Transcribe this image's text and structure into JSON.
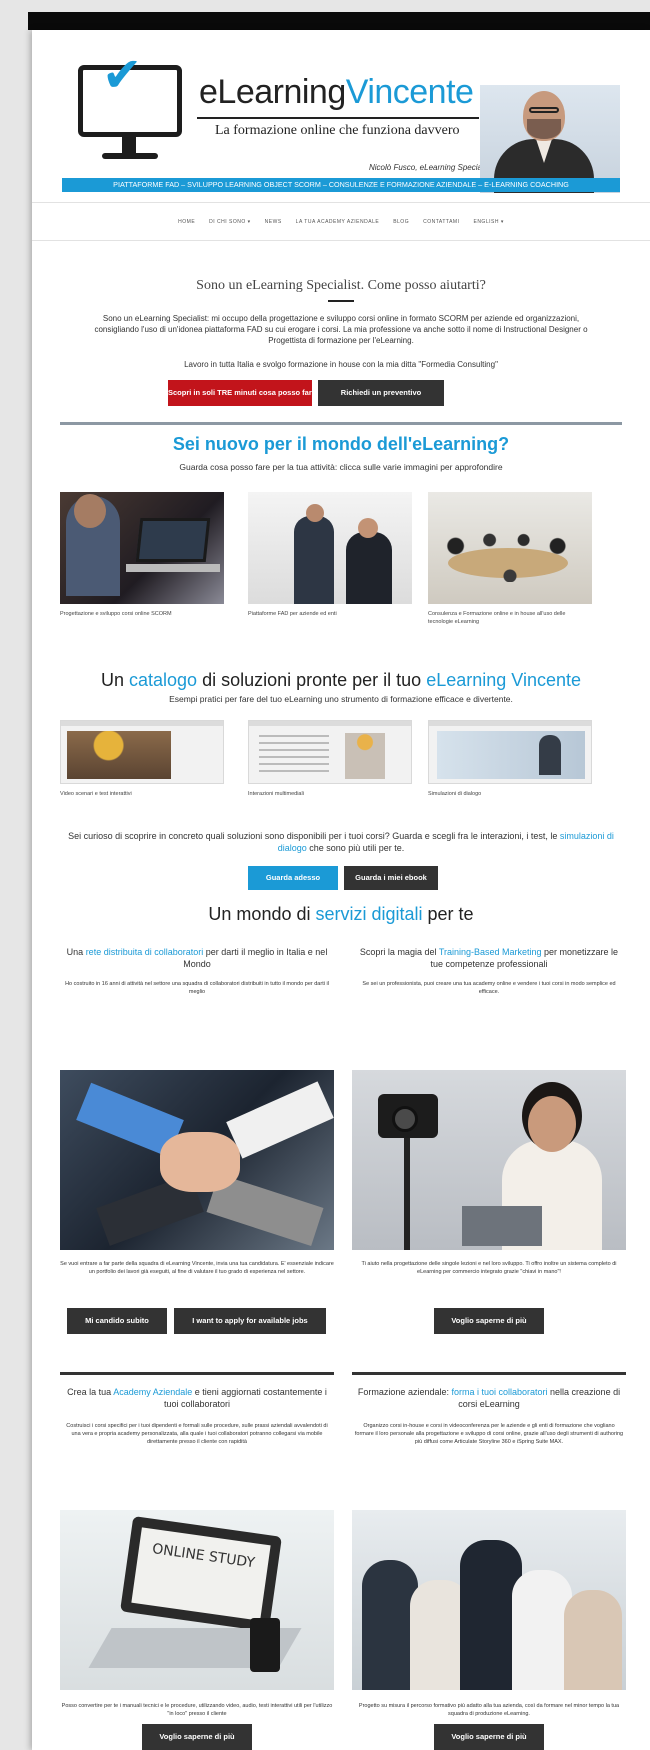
{
  "header": {
    "brand_part1": "eLearning",
    "brand_part2": "Vincente",
    "tagline": "La formazione online che funziona davvero",
    "author": "Nicolò Fusco, eLearning Specialist",
    "services_strip": "PIATTAFORME FAD – SVILUPPO LEARNING OBJECT SCORM – CONSULENZE E FORMAZIONE AZIENDALE – E-LEARNING COACHING",
    "colors": {
      "accent": "#1b9ad6",
      "dark": "#1d1d1d"
    }
  },
  "nav": {
    "items": [
      "HOME",
      "DI CHI SONO ▾",
      "NEWS",
      "LA TUA ACADEMY AZIENDALE",
      "BLOG",
      "CONTATTAMI",
      "ENGLISH ▾"
    ]
  },
  "intro": {
    "title": "Sono un eLearning Specialist. Come posso aiutarti?",
    "paragraph": "Sono un eLearning Specialist: mi occupo della progettazione e sviluppo corsi online in formato SCORM per aziende ed organizzazioni, consigliando l'uso di un'idonea piattaforma FAD su cui erogare i corsi. La mia professione va anche sotto il nome di Instructional Designer o Progettista di formazione per l'eLearning.",
    "paragraph2": "Lavoro in tutta Italia e svolgo formazione in house con la mia ditta \"Formedia Consulting\"",
    "btn_red": "Scopri in soli TRE minuti cosa posso fare per te",
    "btn_dark": "Richiedi un preventivo",
    "colors": {
      "red": "#c2141b",
      "dark": "#333333"
    }
  },
  "new_section": {
    "title": "Sei nuovo per il mondo dell'eLearning?",
    "subtitle": "Guarda cosa posso fare per la tua attività: clicca sulle varie immagini per approfondire",
    "cards": [
      {
        "caption": "Progettazione e sviluppo corsi online SCORM"
      },
      {
        "caption": "Piattaforme FAD per aziende ed enti"
      },
      {
        "caption": "Consulenza e Formazione online e in house all'uso delle tecnologie eLearning"
      }
    ]
  },
  "catalog": {
    "title_a": "Un ",
    "title_hl1": "catalogo",
    "title_b": " di soluzioni pronte per il tuo ",
    "title_hl2": "eLearning Vincente",
    "subtitle": "Esempi pratici per fare del tuo eLearning uno strumento di formazione efficace e divertente.",
    "items": [
      {
        "caption": "Video scenari e test interattivi"
      },
      {
        "caption": "Interazioni multimediali"
      },
      {
        "caption": "Simulazioni di dialogo"
      }
    ],
    "curious_a": "Sei curioso di scoprire in concreto quali soluzioni sono disponibili per i tuoi corsi? Guarda e scegli fra le interazioni, i test, le ",
    "curious_hl": "simulazioni di dialogo",
    "curious_b": " che sono più utili per te.",
    "btn_blue": "Guarda adesso",
    "btn_dark": "Guarda i miei ebook"
  },
  "services": {
    "title_a": "Un mondo di ",
    "title_hl": "servizi digitali",
    "title_b": " per te",
    "col1": {
      "head_a": "Una ",
      "head_hl": "rete distribuita di collaboratori",
      "head_b": " per darti il meglio in Italia e nel Mondo",
      "text": "Ho costruito in 16 anni di attività nel settore una squadra di collaboratori distribuiti in tutto il mondo per darti il meglio",
      "caption": "Se vuoi entrare a far parte della squadra di eLearning Vincente, invia una tua candidatura. E' essenziale indicare un portfolio dei lavori già eseguiti, al fine di valutare il tuo grado di esperienza nel settore.",
      "btn1": "Mi candido subito",
      "btn2": "I want to apply for available jobs"
    },
    "col2": {
      "head_a": "Scopri la magia del ",
      "head_hl": "Training-Based Marketing",
      "head_b": " per monetizzare le tue competenze professionali",
      "text": "Se sei un professionista, puoi creare una tua academy online e vendere i tuoi corsi in modo semplice ed efficace.",
      "caption": "Ti aiuto nella progettazione delle singole lezioni e nel loro sviluppo. Ti offro inoltre un sistema completo di eLearning per commercio integrato grazie \"chiavi in mano\"!",
      "btn": "Voglio saperne di più"
    },
    "col3": {
      "head_a": "Crea la tua ",
      "head_hl": "Academy Aziendale",
      "head_b": " e tieni aggiornati costantemente i tuoi collaboratori",
      "text": "Costruisci i corsi specifici per i tuoi dipendenti e formali sulle procedure, sulle prassi aziendali avvalendoti di una vera e propria academy personalizzata, alla quale i tuoi collaboratori potranno collegarsi via mobile direttamente presso il cliente con rapidità",
      "screen_text": "ONLINE STUDY",
      "caption": "Posso convertire per te i manuali tecnici e le procedure, utilizzando video, audio, testi interattivi utili per l'utilizzo \"in loco\" presso il cliente",
      "btn": "Voglio saperne di più"
    },
    "col4": {
      "head_a": "Formazione aziendale: ",
      "head_hl": "forma i tuoi collaboratori",
      "head_b": " nella creazione di corsi eLearning",
      "text": "Organizzo corsi in-house e corsi in videoconferenza per le aziende e gli enti di formazione che vogliano formare il loro personale alla progettazione e sviluppo di corsi online, grazie all'uso degli strumenti di authoring più diffusi come Articulate Storyline 360 e iSpring Suite MAX.",
      "caption": "Progetto su misura il percorso formativo più adatto alla tua azienda, così da formare nel minor tempo la tua squadra di produzione eLearning.",
      "btn": "Voglio saperne di più"
    }
  }
}
